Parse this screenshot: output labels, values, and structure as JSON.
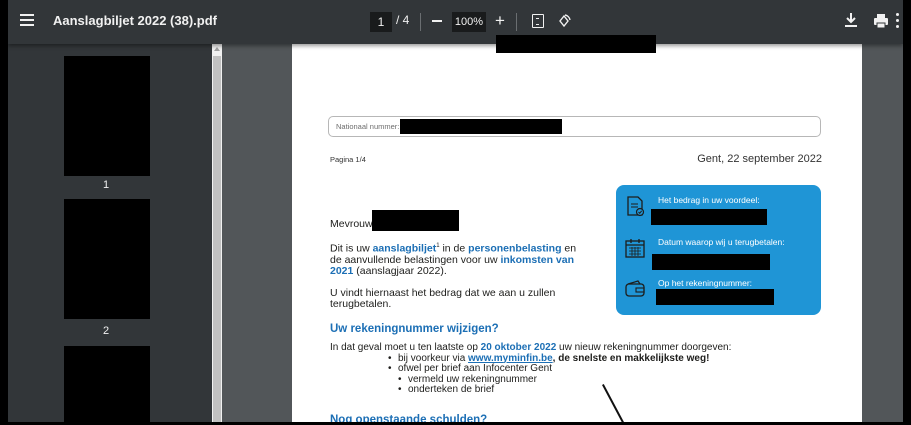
{
  "toolbar": {
    "title": "Aanslagbiljet 2022 (38).pdf",
    "current_page": "1",
    "page_total": "/ 4",
    "zoom": "100%",
    "zoom_in_label": "+"
  },
  "sidebar": {
    "thumbnails": [
      {
        "label": "1"
      },
      {
        "label": "2"
      }
    ]
  },
  "document": {
    "nationaal_nummer_label": "Nationaal nummer:",
    "pagina": "Pagina 1/4",
    "place_date": "Gent, 22 september 2022",
    "info_box": {
      "bedrag_label": "Het bedrag in uw voordeel:",
      "datum_label": "Datum waarop wij u terugbetalen:",
      "rekening_label": "Op het rekeningnummer:"
    },
    "salutation": "Mevrouw",
    "intro": {
      "t1": "Dit is uw ",
      "aanslagbiljet": "aanslagbiljet",
      "sup": "1",
      "t2": " in de ",
      "personenbelasting": "personenbelasting",
      "t3": " en de aanvullende belastingen voor uw ",
      "inkomsten": "inkomsten van 2021",
      "t4": " (aanslagjaar 2022)."
    },
    "paragraph2": "U vindt hiernaast het bedrag dat we aan u zullen terugbetalen.",
    "heading1": "Uw rekeningnummer wijzigen?",
    "change_intro_1": "In dat geval moet u ten laatste op ",
    "change_date": "20 oktober 2022",
    "change_intro_2": " uw nieuw rekeningnummer doorgeven:",
    "bullet1_a": "bij voorkeur via ",
    "bullet1_link": "www.myminfin.be",
    "bullet1_b": ", de snelste en makkelijkste weg!",
    "bullet2": "ofwel per brief aan Infocenter Gent",
    "sub1": "vermeld uw rekeningnummer",
    "sub2": "onderteken de brief",
    "heading2": "Nog openstaande schulden?"
  },
  "colors": {
    "toolbar_bg": "#323639",
    "viewer_bg": "#525659",
    "info_box_blue": "#1f95d6",
    "text_blue": "#1c6fb5"
  },
  "icons": [
    "menu-icon",
    "zoom-out-icon",
    "zoom-in-icon",
    "fit-page-icon",
    "rotate-icon",
    "download-icon",
    "print-icon",
    "more-icon",
    "document-check-icon",
    "calendar-icon",
    "wallet-icon"
  ]
}
